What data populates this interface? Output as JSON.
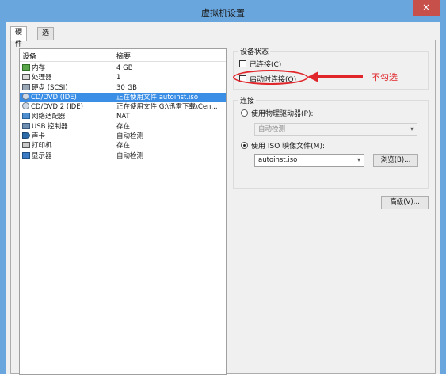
{
  "window": {
    "title": "虚拟机设置",
    "close_glyph": "×"
  },
  "tabs": [
    {
      "label": "硬件",
      "active": true
    },
    {
      "label": "选项",
      "active": false
    }
  ],
  "device_list": {
    "headers": {
      "device": "设备",
      "summary": "摘要"
    },
    "rows": [
      {
        "device": "内存",
        "summary": "4 GB",
        "icon": "memory-icon"
      },
      {
        "device": "处理器",
        "summary": "1",
        "icon": "processor-icon"
      },
      {
        "device": "硬盘 (SCSI)",
        "summary": "30 GB",
        "icon": "hard-disk-icon"
      },
      {
        "device": "CD/DVD (IDE)",
        "summary": "正在使用文件 autoinst.iso",
        "icon": "cd-dvd-icon",
        "selected": true
      },
      {
        "device": "CD/DVD 2 (IDE)",
        "summary": "正在使用文件 G:\\迅雷下载\\Cen...",
        "icon": "cd-dvd-icon"
      },
      {
        "device": "网络适配器",
        "summary": "NAT",
        "icon": "network-adapter-icon"
      },
      {
        "device": "USB 控制器",
        "summary": "存在",
        "icon": "usb-icon"
      },
      {
        "device": "声卡",
        "summary": "自动检测",
        "icon": "sound-card-icon"
      },
      {
        "device": "打印机",
        "summary": "存在",
        "icon": "printer-icon"
      },
      {
        "device": "显示器",
        "summary": "自动检测",
        "icon": "display-icon"
      }
    ]
  },
  "device_status": {
    "title": "设备状态",
    "connected_label": "已连接(C)",
    "connect_at_power_on_label": "启动时连接(O)"
  },
  "connection": {
    "title": "连接",
    "physical_drive_label": "使用物理驱动器(P):",
    "physical_drive_value": "自动检测",
    "iso_label": "使用 ISO 映像文件(M):",
    "iso_value": "autoinst.iso",
    "browse_label": "浏览(B)..."
  },
  "advanced_label": "高级(V)...",
  "annotation": {
    "text": "不勾选",
    "color": "#e0262b"
  }
}
